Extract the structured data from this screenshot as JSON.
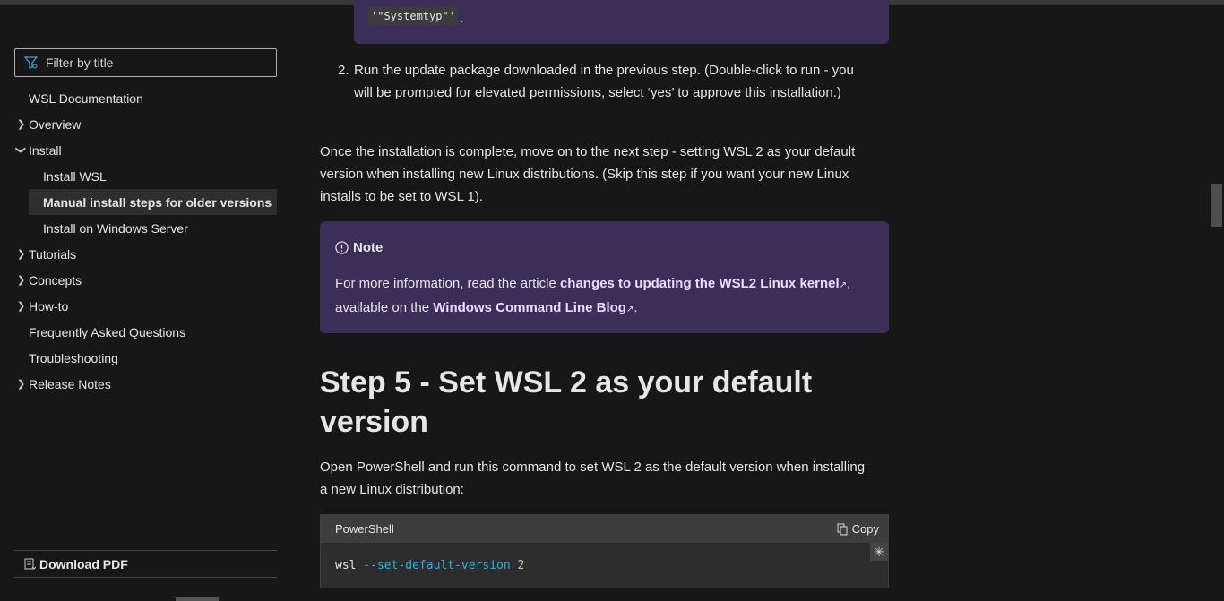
{
  "sidebar": {
    "filter_placeholder": "Filter by title",
    "items": [
      {
        "label": "WSL Documentation"
      },
      {
        "label": "Overview"
      },
      {
        "label": "Install"
      },
      {
        "label": "Install WSL"
      },
      {
        "label": "Manual install steps for older versions"
      },
      {
        "label": "Install on Windows Server"
      },
      {
        "label": "Tutorials"
      },
      {
        "label": "Concepts"
      },
      {
        "label": "How-to"
      },
      {
        "label": "Frequently Asked Questions"
      },
      {
        "label": "Troubleshooting"
      },
      {
        "label": "Release Notes"
      }
    ],
    "download_pdf": "Download PDF"
  },
  "main": {
    "inline_code": "'\"Systemtyp\"'",
    "inline_period": ".",
    "step2_num": "2.",
    "step2_text": "Run the update package downloaded in the previous step. (Double-click to run - you will be prompted for elevated permissions, select ‘yes’ to approve this installation.)",
    "para1": "Once the installation is complete, move on to the next step - setting WSL 2 as your default version when installing new Linux distributions. (Skip this step if you want your new Linux installs to be set to WSL 1).",
    "note": {
      "title": "Note",
      "text1": "For more information, read the article ",
      "link1": "changes to updating the WSL2 Linux kernel",
      "text2": ", available on the ",
      "link2": "Windows Command Line Blog",
      "text3": "."
    },
    "heading": "Step 5 - Set WSL 2 as your default version",
    "para2": "Open PowerShell and run this command to set WSL 2 as the default version when installing a new Linux distribution:",
    "code": {
      "lang": "PowerShell",
      "copy": "Copy",
      "cmd": "wsl",
      "flag": "--set-default-version",
      "arg": "2"
    }
  }
}
